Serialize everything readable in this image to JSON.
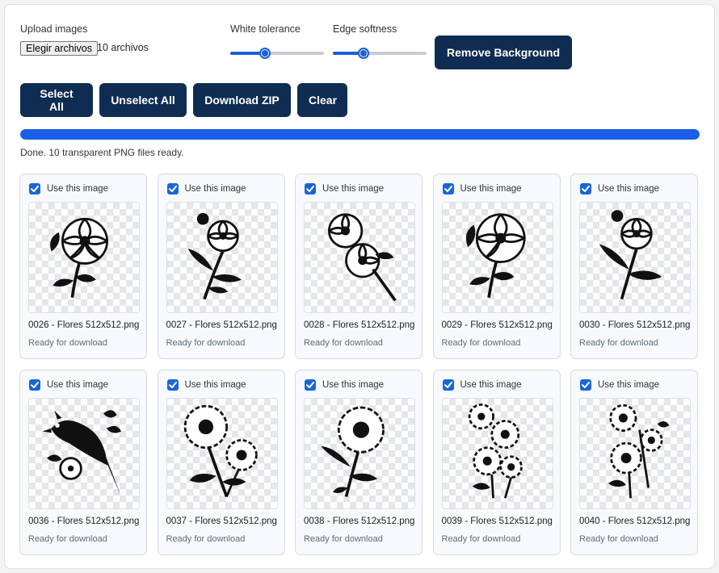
{
  "controls": {
    "upload_label": "Upload images",
    "file_button": "Elegir archivos",
    "file_count": "10 archivos",
    "white_tolerance_label": "White tolerance",
    "white_tolerance_level": 0.35,
    "edge_softness_label": "Edge softness",
    "edge_softness_level": 0.3,
    "remove_bg_button": "Remove Background"
  },
  "toolbar": {
    "select_all": "Select All",
    "unselect_all": "Unselect All",
    "download_zip": "Download ZIP",
    "clear": "Clear"
  },
  "progress": {
    "percent": 100,
    "status": "Done. 10 transparent PNG files ready."
  },
  "colors": {
    "accent": "#1a5fe6",
    "button_bg": "#0f2d52",
    "checkbox": "#1a66d6"
  },
  "cards": [
    {
      "checked": true,
      "use_label": "Use this image",
      "filename": "0026 - Flores 512x512.png",
      "status": "Ready for download",
      "icon": "flower-drawing-icon"
    },
    {
      "checked": true,
      "use_label": "Use this image",
      "filename": "0027 - Flores 512x512.png",
      "status": "Ready for download",
      "icon": "flower-stem-drawing-icon"
    },
    {
      "checked": true,
      "use_label": "Use this image",
      "filename": "0028 - Flores 512x512.png",
      "status": "Ready for download",
      "icon": "flower-pair-drawing-icon"
    },
    {
      "checked": true,
      "use_label": "Use this image",
      "filename": "0029 - Flores 512x512.png",
      "status": "Ready for download",
      "icon": "flower-drawing-icon"
    },
    {
      "checked": true,
      "use_label": "Use this image",
      "filename": "0030 - Flores 512x512.png",
      "status": "Ready for download",
      "icon": "flower-stem-drawing-icon"
    },
    {
      "checked": true,
      "use_label": "Use this image",
      "filename": "0036 - Flores 512x512.png",
      "status": "Ready for download",
      "icon": "bird-flower-drawing-icon"
    },
    {
      "checked": true,
      "use_label": "Use this image",
      "filename": "0037 - Flores 512x512.png",
      "status": "Ready for download",
      "icon": "sunflower-drawing-icon"
    },
    {
      "checked": true,
      "use_label": "Use this image",
      "filename": "0038 - Flores 512x512.png",
      "status": "Ready for download",
      "icon": "daisy-drawing-icon"
    },
    {
      "checked": true,
      "use_label": "Use this image",
      "filename": "0039 - Flores 512x512.png",
      "status": "Ready for download",
      "icon": "daisy-bouquet-drawing-icon"
    },
    {
      "checked": true,
      "use_label": "Use this image",
      "filename": "0040 - Flores 512x512.png",
      "status": "Ready for download",
      "icon": "daisy-bouquet-drawing-icon"
    }
  ]
}
